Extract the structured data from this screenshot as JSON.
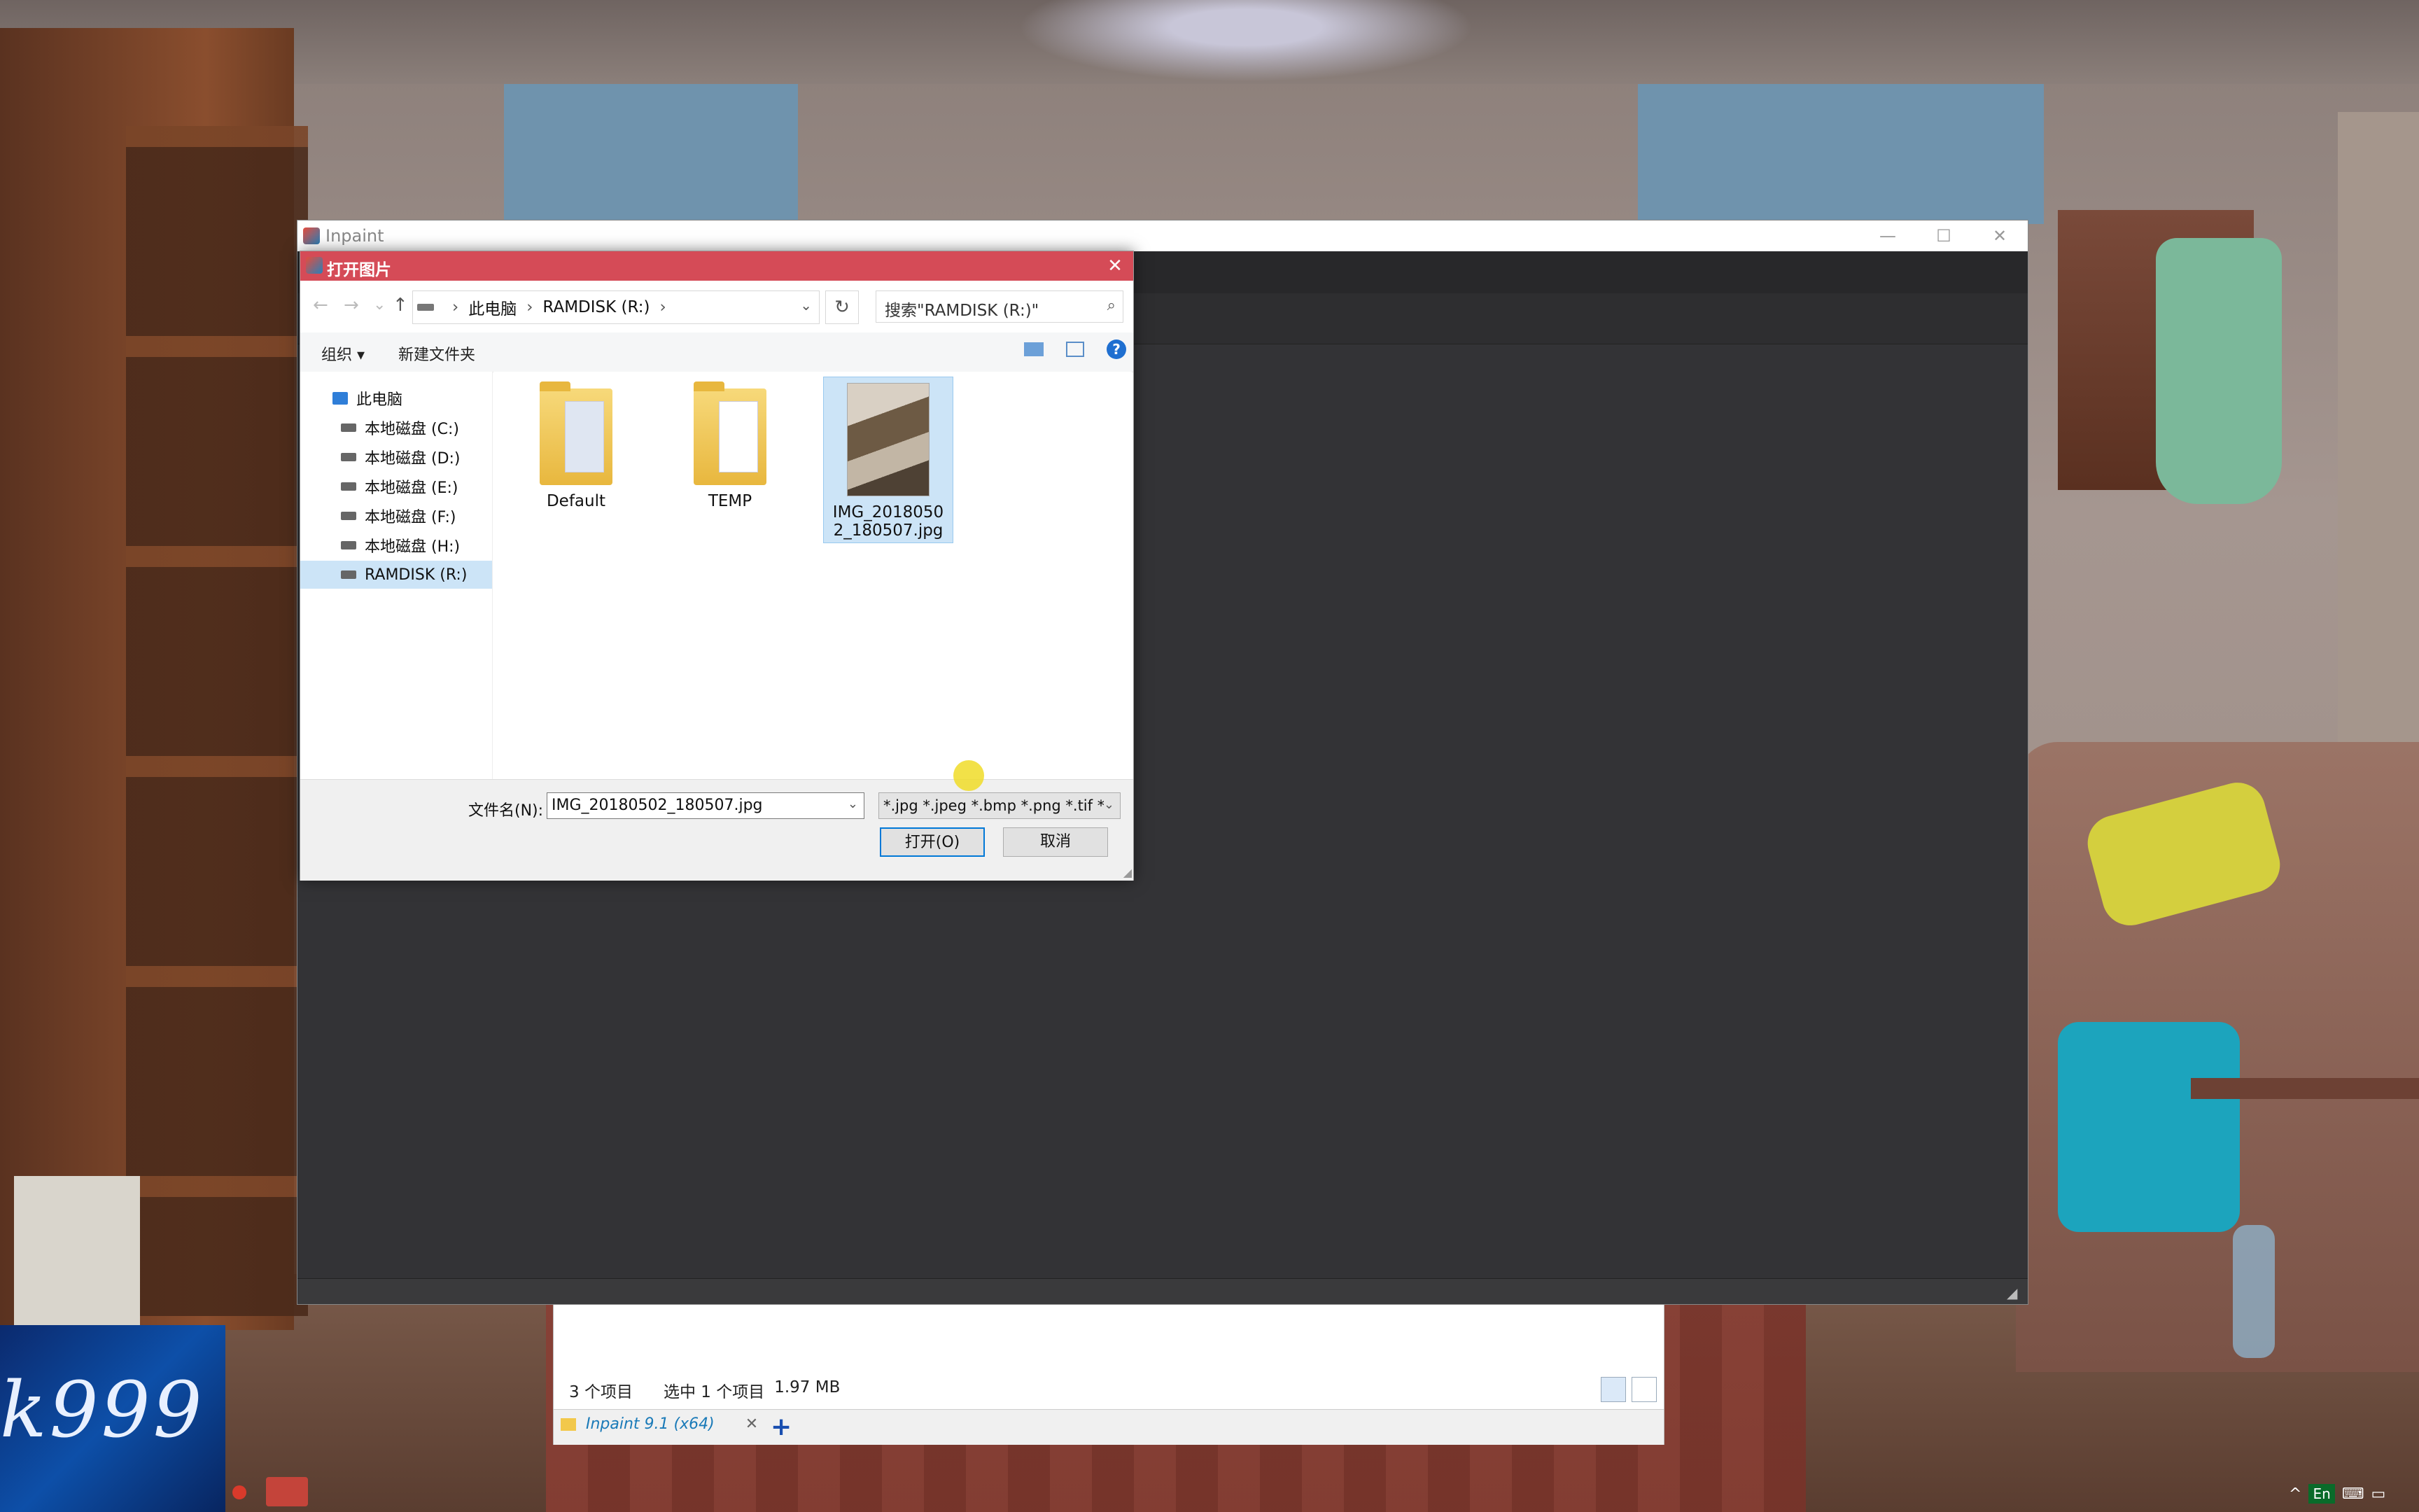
{
  "desktop": {
    "widget_text": "k999"
  },
  "tray": {
    "lang": "En"
  },
  "explorer": {
    "status_count": "3 个项目",
    "status_selected": "选中 1 个项目",
    "status_size": "1.97 MB",
    "tab_label": "Inpaint 9.1 (x64)"
  },
  "inpaint": {
    "title": "Inpaint"
  },
  "dialog": {
    "title": "打开图片",
    "address": {
      "root": "此电脑",
      "current": "RAMDISK (R:)"
    },
    "search_placeholder": "搜索\"RAMDISK (R:)\"",
    "toolbar": {
      "organize": "组织",
      "new_folder": "新建文件夹"
    },
    "tree": [
      {
        "label": "此电脑"
      },
      {
        "label": "本地磁盘 (C:)"
      },
      {
        "label": "本地磁盘 (D:)"
      },
      {
        "label": "本地磁盘 (E:)"
      },
      {
        "label": "本地磁盘 (F:)"
      },
      {
        "label": "本地磁盘 (H:)"
      },
      {
        "label": "RAMDISK (R:)"
      }
    ],
    "files": [
      {
        "name": "Default"
      },
      {
        "name": "TEMP"
      },
      {
        "name_line1": "IMG_2018050",
        "name_line2": "2_180507.jpg"
      }
    ],
    "filename_label": "文件名(N):",
    "filename_value": "IMG_20180502_180507.jpg",
    "filetype_value": "*.jpg *.jpeg *.bmp *.png *.tif *",
    "open_label": "打开(O)",
    "cancel_label": "取消"
  }
}
